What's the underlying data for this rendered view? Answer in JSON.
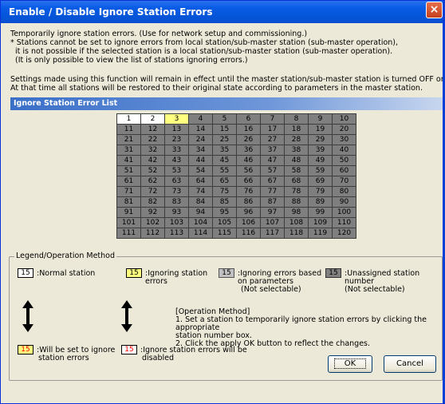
{
  "window": {
    "title": "Enable / Disable Ignore Station Errors",
    "close_label": "×"
  },
  "intro": [
    "Temporarily ignore station errors. (Use for network setup and commissioning.)",
    "* Stations cannot be set to ignore errors from local station/sub-master station (sub-master operation),",
    "  it is not possible if the selected station is a local station/sub-master station (sub-master operation).",
    "  (It is only possible to view the list of stations ignoring errors.)"
  ],
  "settings_note": [
    "Settings made using this function will remain in effect until the master station/sub-master station is turned OFF or reset.",
    "At that time all stations will be restored to their original state according to parameters in the master station."
  ],
  "list_title": "Ignore Station Error List",
  "grid": {
    "rows": [
      [
        "1",
        "2",
        "3",
        "4",
        "5",
        "6",
        "7",
        "8",
        "9",
        "10"
      ],
      [
        "11",
        "12",
        "13",
        "14",
        "15",
        "16",
        "17",
        "18",
        "19",
        "20"
      ],
      [
        "21",
        "22",
        "23",
        "24",
        "25",
        "26",
        "27",
        "28",
        "29",
        "30"
      ],
      [
        "31",
        "32",
        "33",
        "34",
        "35",
        "36",
        "37",
        "38",
        "39",
        "40"
      ],
      [
        "41",
        "42",
        "43",
        "44",
        "45",
        "46",
        "47",
        "48",
        "49",
        "50"
      ],
      [
        "51",
        "52",
        "53",
        "54",
        "55",
        "56",
        "57",
        "58",
        "59",
        "60"
      ],
      [
        "61",
        "62",
        "63",
        "64",
        "65",
        "66",
        "67",
        "68",
        "69",
        "70"
      ],
      [
        "71",
        "72",
        "73",
        "74",
        "75",
        "76",
        "77",
        "78",
        "79",
        "80"
      ],
      [
        "81",
        "82",
        "83",
        "84",
        "85",
        "86",
        "87",
        "88",
        "89",
        "90"
      ],
      [
        "91",
        "92",
        "93",
        "94",
        "95",
        "96",
        "97",
        "98",
        "99",
        "100"
      ],
      [
        "101",
        "102",
        "103",
        "104",
        "105",
        "106",
        "107",
        "108",
        "109",
        "110"
      ],
      [
        "111",
        "112",
        "113",
        "114",
        "115",
        "116",
        "117",
        "118",
        "119",
        "120"
      ]
    ],
    "normal_stations": [
      "1",
      "2"
    ],
    "ignoring_stations": [
      "3"
    ]
  },
  "legend": {
    "title": "Legend/Operation Method",
    "chip_number": "15",
    "normal_label": ":Normal station",
    "ignoring_label_1": ":Ignoring station",
    "ignoring_label_2": "errors",
    "param_label_1": ":Ignoring errors based",
    "param_label_2": "on parameters",
    "param_label_3": "(Not selectable)",
    "unassigned_label_1": ":Unassigned station number",
    "unassigned_label_2": "(Not selectable)",
    "will_set_label_1": ":Will be set to ignore",
    "will_set_label_2": "station errors",
    "will_disable_label_1": ":Ignore station errors will be",
    "will_disable_label_2": "disabled",
    "op_method": [
      "[Operation Method]",
      "1. Set a station to temporarily ignore station  errors by clicking the appropriate",
      "station number box.",
      "2. Click the apply OK button to reflect the changes."
    ]
  },
  "buttons": {
    "ok": "OK",
    "cancel": "Cancel"
  },
  "colors": {
    "title_bar": "#0a5ce6",
    "dialog_bg": "#ece9d8",
    "unassigned": "#7f7f7f",
    "ignoring": "#ffff80"
  }
}
